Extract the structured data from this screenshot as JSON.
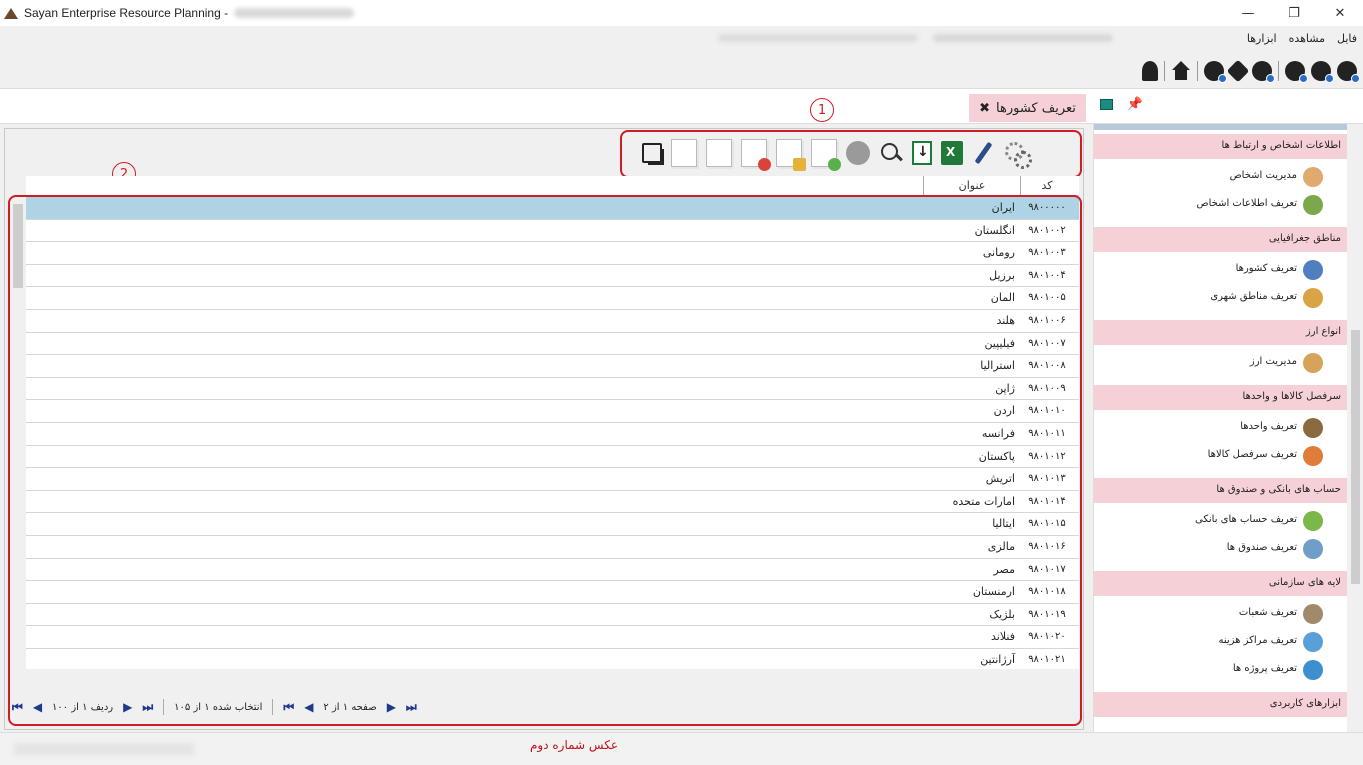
{
  "window": {
    "title": "Sayan Enterprise Resource Planning -",
    "minimize": "—",
    "restore": "❐",
    "close": "✕"
  },
  "menu": {
    "items": [
      "فایل",
      "مشاهده",
      "ابزارها"
    ]
  },
  "tab": {
    "label": "تعریف کشورها",
    "close": "✖"
  },
  "annotations": {
    "toolbar_number": "1",
    "grid_number": "2"
  },
  "grid": {
    "columns": {
      "code": "کد",
      "title": "عنوان"
    },
    "rows": [
      {
        "code": "۹۸۰۰۰۰۰",
        "title": "ایران",
        "selected": true
      },
      {
        "code": "۹۸۰۱۰۰۲",
        "title": "انگلستان"
      },
      {
        "code": "۹۸۰۱۰۰۳",
        "title": "رومانی"
      },
      {
        "code": "۹۸۰۱۰۰۴",
        "title": "برزیل"
      },
      {
        "code": "۹۸۰۱۰۰۵",
        "title": "المان"
      },
      {
        "code": "۹۸۰۱۰۰۶",
        "title": "هلند"
      },
      {
        "code": "۹۸۰۱۰۰۷",
        "title": "فیلیپین"
      },
      {
        "code": "۹۸۰۱۰۰۸",
        "title": "استرالیا"
      },
      {
        "code": "۹۸۰۱۰۰۹",
        "title": "ژاپن"
      },
      {
        "code": "۹۸۰۱۰۱۰",
        "title": "اردن"
      },
      {
        "code": "۹۸۰۱۰۱۱",
        "title": "فرانسه"
      },
      {
        "code": "۹۸۰۱۰۱۲",
        "title": "پاکستان"
      },
      {
        "code": "۹۸۰۱۰۱۳",
        "title": "اتریش"
      },
      {
        "code": "۹۸۰۱۰۱۴",
        "title": "امارات متحده"
      },
      {
        "code": "۹۸۰۱۰۱۵",
        "title": "ایتالیا"
      },
      {
        "code": "۹۸۰۱۰۱۶",
        "title": "مالزی"
      },
      {
        "code": "۹۸۰۱۰۱۷",
        "title": "مصر"
      },
      {
        "code": "۹۸۰۱۰۱۸",
        "title": "ارمنستان"
      },
      {
        "code": "۹۸۰۱۰۱۹",
        "title": "بلژیک"
      },
      {
        "code": "۹۸۰۱۰۲۰",
        "title": "فنلاند"
      },
      {
        "code": "۹۸۰۱۰۲۱",
        "title": "آرژانتین"
      }
    ]
  },
  "pager": {
    "page_text": "صفحه ۱ از ۲",
    "selected_text": "انتخاب شده ۱ از ۱۰۵",
    "row_text": "ردیف ۱ از ۱۰۰"
  },
  "caption": "عکس شماره دوم",
  "sidebar": {
    "sections": [
      {
        "title": "اطلاعات اشخاص و ارتباط ها",
        "items": [
          "مدیریت اشخاص",
          "تعریف اطلاعات اشخاص"
        ]
      },
      {
        "title": "مناطق جغرافیایی",
        "items": [
          "تعریف کشورها",
          "تعریف مناطق شهری"
        ]
      },
      {
        "title": "انواع ارز",
        "items": [
          "مدیریت ارز"
        ]
      },
      {
        "title": "سرفصل کالاها و واحدها",
        "items": [
          "تعریف واحدها",
          "تعریف سرفصل کالاها"
        ]
      },
      {
        "title": "حساب های بانکی و صندوق ها",
        "items": [
          "تعریف حساب های بانکی",
          "تعریف صندوق ها"
        ]
      },
      {
        "title": "لایه های سازمانی",
        "items": [
          "تعریف شعبات",
          "تعریف مراکز هزینه",
          "تعریف پروژه ها"
        ]
      },
      {
        "title": "ابزارهای کاربردی",
        "items": []
      }
    ]
  },
  "colors": {
    "accent_pink": "#f6d0d7",
    "selection": "#aed3e5",
    "annotation_red": "#d01d24"
  }
}
